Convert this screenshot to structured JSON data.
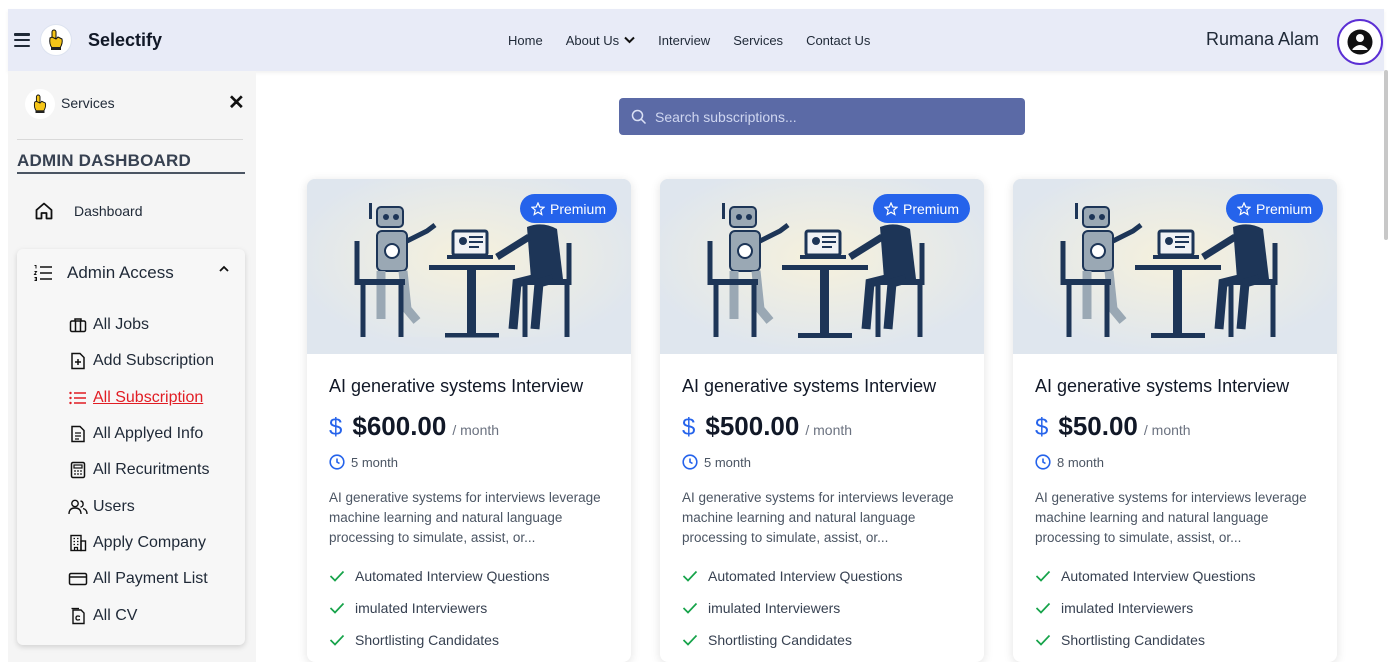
{
  "header": {
    "brand": "Selectify",
    "nav": [
      {
        "label": "Home"
      },
      {
        "label": "About Us"
      },
      {
        "label": "Interview"
      },
      {
        "label": "Services"
      },
      {
        "label": "Contact Us"
      }
    ],
    "user_name": "Rumana Alam"
  },
  "sidebar": {
    "title": "Services",
    "dashboard_heading": "ADMIN DASHBOARD",
    "dashboard_label": "Dashboard",
    "access_label": "Admin Access",
    "items": [
      {
        "label": "All Jobs",
        "icon": "briefcase-icon"
      },
      {
        "label": "Add Subscription",
        "icon": "file-plus-icon"
      },
      {
        "label": "All Subscription",
        "icon": "list-icon",
        "active": true
      },
      {
        "label": "All Applyed Info",
        "icon": "document-icon"
      },
      {
        "label": "All Recuritments",
        "icon": "calculator-icon"
      },
      {
        "label": "Users",
        "icon": "users-icon"
      },
      {
        "label": "Apply Company",
        "icon": "building-icon"
      },
      {
        "label": "All Payment List",
        "icon": "credit-card-icon"
      },
      {
        "label": "All CV",
        "icon": "cv-file-icon"
      }
    ]
  },
  "search": {
    "placeholder": "Search subscriptions..."
  },
  "cards": [
    {
      "badge": "Premium",
      "title": "AI generative systems Interview",
      "currency": "$",
      "price": "$600.00",
      "period": "/ month",
      "duration": "5 month",
      "description": "AI generative systems for interviews leverage machine learning and natural language processing to simulate, assist, or...",
      "features": [
        "Automated Interview Questions",
        "imulated Interviewers",
        "Shortlisting Candidates"
      ]
    },
    {
      "badge": "Premium",
      "title": "AI generative systems Interview",
      "currency": "$",
      "price": "$500.00",
      "period": "/ month",
      "duration": "5 month",
      "description": "AI generative systems for interviews leverage machine learning and natural language processing to simulate, assist, or...",
      "features": [
        "Automated Interview Questions",
        "imulated Interviewers",
        "Shortlisting Candidates"
      ]
    },
    {
      "badge": "Premium",
      "title": "AI generative systems Interview",
      "currency": "$",
      "price": "$50.00",
      "period": "/ month",
      "duration": "8 month",
      "description": "AI generative systems for interviews leverage machine learning and natural language processing to simulate, assist, or...",
      "features": [
        "Automated Interview Questions",
        "imulated Interviewers",
        "Shortlisting Candidates"
      ]
    }
  ],
  "colors": {
    "accent": "#2563eb",
    "active_menu": "#e11d24",
    "search_bg": "#5b6aa6",
    "header_bg": "#e8ebf7",
    "avatar_ring": "#5b2fd4"
  }
}
